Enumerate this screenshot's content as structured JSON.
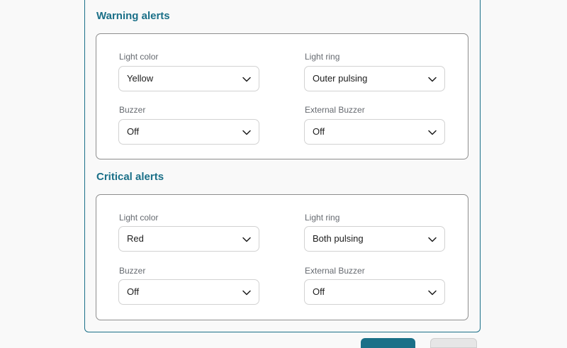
{
  "warning": {
    "title": "Warning alerts",
    "light_color": {
      "label": "Light color",
      "value": "Yellow"
    },
    "light_ring": {
      "label": "Light ring",
      "value": "Outer pulsing"
    },
    "buzzer": {
      "label": "Buzzer",
      "value": "Off"
    },
    "external_buzzer": {
      "label": "External Buzzer",
      "value": "Off"
    }
  },
  "critical": {
    "title": "Critical alerts",
    "light_color": {
      "label": "Light color",
      "value": "Red"
    },
    "light_ring": {
      "label": "Light ring",
      "value": "Both pulsing"
    },
    "buzzer": {
      "label": "Buzzer",
      "value": "Off"
    },
    "external_buzzer": {
      "label": "External Buzzer",
      "value": "Off"
    }
  },
  "icons": {
    "dropdown": "chevron-down-icon"
  },
  "colors": {
    "accent": "#1b7088",
    "label": "#666a70",
    "group_border": "#8e8e8e",
    "select_border": "#d2d2d2"
  }
}
